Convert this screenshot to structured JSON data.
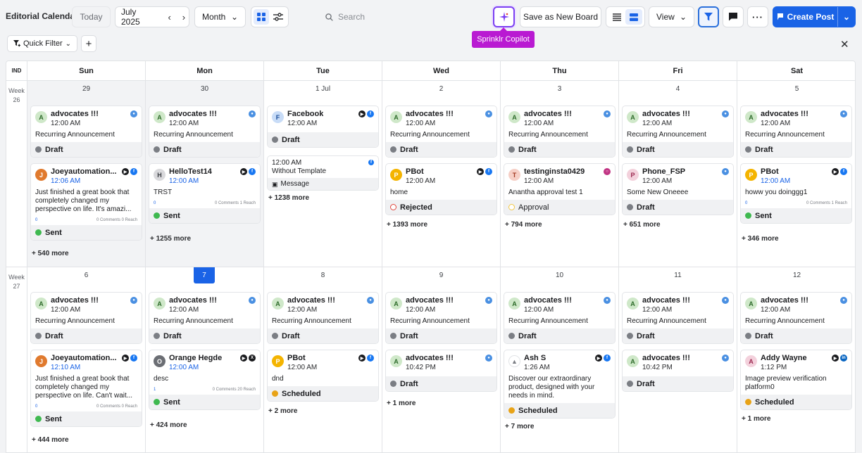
{
  "header": {
    "title": "Editorial Calendar",
    "today_label": "Today",
    "month_label": "July 2025",
    "view_range": "Month",
    "search_placeholder": "Search",
    "copilot_tooltip": "Sprinklr Copilot",
    "save_board_label": "Save as New Board",
    "view_label": "View",
    "create_label": "Create Post"
  },
  "filters": {
    "quick_filter_label": "Quick Filter"
  },
  "calendar": {
    "ind_label": "IND",
    "days": [
      "Sun",
      "Mon",
      "Tue",
      "Wed",
      "Thu",
      "Fri",
      "Sat"
    ],
    "weeks": [
      {
        "label": "Week",
        "number": "26",
        "dates": [
          "29",
          "30",
          "1 Jul",
          "2",
          "3",
          "4",
          "5"
        ]
      },
      {
        "label": "Week",
        "number": "27",
        "dates": [
          "6",
          "7",
          "8",
          "9",
          "10",
          "11",
          "12"
        ]
      }
    ],
    "today_date": "7",
    "more": {
      "w26": [
        "+ 540 more",
        "+ 1255 more",
        "+ 1238 more",
        "+ 1393 more",
        "+ 794 more",
        "+ 651 more",
        "+ 346 more"
      ],
      "w27": [
        "+ 444 more",
        "+ 424 more",
        "+ 2 more",
        "+ 1 more",
        "+ 7 more",
        "",
        "+ 1 more"
      ]
    }
  },
  "posts": {
    "recurring": {
      "account": "advocates !!!",
      "time": "12:00 AM",
      "text": "Recurring Announcement",
      "status": "Draft"
    },
    "sun26b": {
      "account": "Joeyautomation...",
      "time": "12:06 AM",
      "text": "Just finished a great book that completely changed my perspective on life. It's amazi...",
      "stats": "0 Comments 0 Reach",
      "reactions": "0",
      "status": "Sent"
    },
    "mon26b": {
      "account": "HelloTest14",
      "avatar": "H",
      "time": "12:00 AM",
      "text": "TRST",
      "stats": "0 Comments 1 Reach",
      "reactions": "0",
      "status": "Sent"
    },
    "tue26a": {
      "account": "Facebook",
      "avatar": "F",
      "time": "12:00 AM",
      "status": "Draft"
    },
    "tue26b": {
      "time": "12:00 AM",
      "text": "Without Template",
      "kind": "Message"
    },
    "wed26b": {
      "account": "PBot",
      "time": "12:00 AM",
      "text": "home",
      "status": "Rejected"
    },
    "thu26b": {
      "account": "testinginsta0429",
      "avatar": "T",
      "time": "12:00 AM",
      "text": "Anantha approval test 1",
      "status": "Approval"
    },
    "fri26b": {
      "account": "Phone_FSP",
      "avatar": "P",
      "time": "12:00 AM",
      "text": "Some New Oneeee",
      "status": "Draft"
    },
    "sat26b": {
      "account": "PBot",
      "time": "12:00 AM",
      "text": "howw you doinggg1",
      "stats": "0 Comments 1 Reach",
      "reactions": "0",
      "status": "Sent"
    },
    "sun27b": {
      "account": "Joeyautomation...",
      "time": "12:10 AM",
      "text": "Just finished a great book that completely changed my perspective on life. Can't wait...",
      "stats": "0 Comments 0 Reach",
      "reactions": "0",
      "status": "Sent"
    },
    "mon27b": {
      "account": "Orange Hegde",
      "time": "12:00 AM",
      "text": "desc",
      "stats": "0 Comments 20 Reach",
      "reactions": "1",
      "status": "Sent"
    },
    "tue27b": {
      "account": "PBot",
      "time": "12:00 AM",
      "text": "dnd",
      "status": "Scheduled"
    },
    "wed27b": {
      "account": "advocates !!!",
      "time": "10:42 PM",
      "status": "Draft"
    },
    "thu27b": {
      "account": "Ash S",
      "time": "1:26 AM",
      "text": "Discover our extraordinary product, designed with your needs in mind.",
      "status": "Scheduled"
    },
    "fri27b": {
      "account": "advocates !!!",
      "time": "10:42 PM",
      "status": "Draft"
    },
    "sat27b": {
      "account": "Addy Wayne",
      "avatar": "A",
      "time": "1:12 PM",
      "text": "Image preview verification platform0",
      "status": "Scheduled"
    }
  },
  "colors": {
    "accent": "#1a63e6",
    "draft": "#7b7e84",
    "sent": "#3fb950",
    "scheduled": "#e8a317",
    "rejected": "#e0463e",
    "approval": "#f2c744",
    "copilot": "#b91ad2"
  }
}
